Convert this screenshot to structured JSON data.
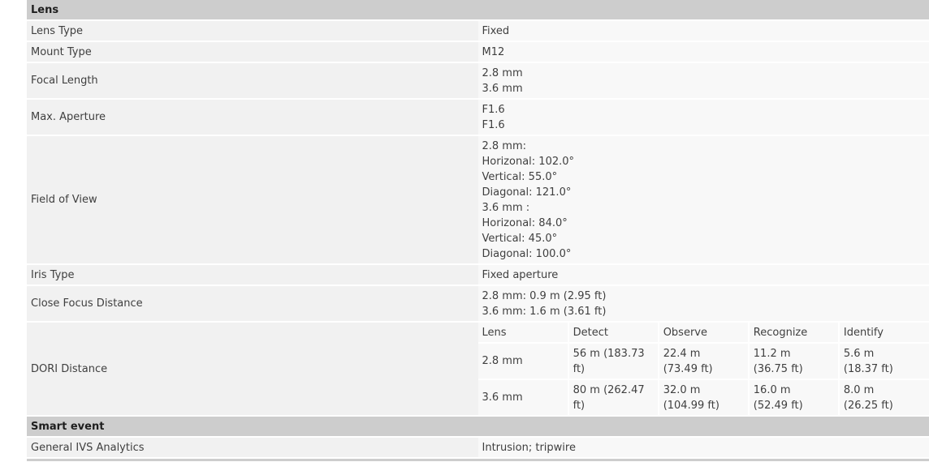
{
  "sections": {
    "lens": "Lens",
    "smart_event": "Smart event"
  },
  "lens": {
    "lens_type": {
      "label": "Lens Type",
      "value": "Fixed"
    },
    "mount_type": {
      "label": "Mount Type",
      "value": "M12"
    },
    "focal_length": {
      "label": "Focal Length",
      "lines": [
        "2.8 mm",
        "3.6 mm"
      ]
    },
    "max_aperture": {
      "label": "Max. Aperture",
      "lines": [
        "F1.6",
        "F1.6"
      ]
    },
    "field_of_view": {
      "label": "Field of View",
      "lines": [
        "2.8 mm:",
        "Horizonal: 102.0°",
        "Vertical: 55.0°",
        "Diagonal: 121.0°",
        "3.6 mm :",
        "Horizonal: 84.0°",
        "Vertical: 45.0°",
        "Diagonal: 100.0°"
      ]
    },
    "iris_type": {
      "label": "Iris Type",
      "value": "Fixed aperture"
    },
    "close_focus": {
      "label": "Close Focus Distance",
      "lines": [
        "2.8 mm: 0.9 m (2.95 ft)",
        "3.6 mm: 1.6 m (3.61 ft)"
      ]
    },
    "dori": {
      "label": "DORI Distance",
      "headers": [
        "Lens",
        "Detect",
        "Observe",
        "Recognize",
        "Identify"
      ],
      "rows": [
        {
          "lens": "2.8 mm",
          "detect": "56 m (183.73 ft)",
          "observe": [
            "22.4 m",
            "(73.49 ft)"
          ],
          "recognize": [
            "11.2 m",
            "(36.75 ft)"
          ],
          "identify": [
            "5.6 m",
            "(18.37 ft)"
          ]
        },
        {
          "lens": "3.6 mm",
          "detect": "80 m (262.47 ft)",
          "observe": "32.0 m (104.99 ft)",
          "recognize": [
            "16.0 m",
            "(52.49 ft)"
          ],
          "identify": [
            "8.0 m",
            "(26.25 ft)"
          ]
        }
      ]
    }
  },
  "smart_event": {
    "general_ivs": {
      "label": "General IVS Analytics",
      "value": "Intrusion; tripwire"
    }
  }
}
